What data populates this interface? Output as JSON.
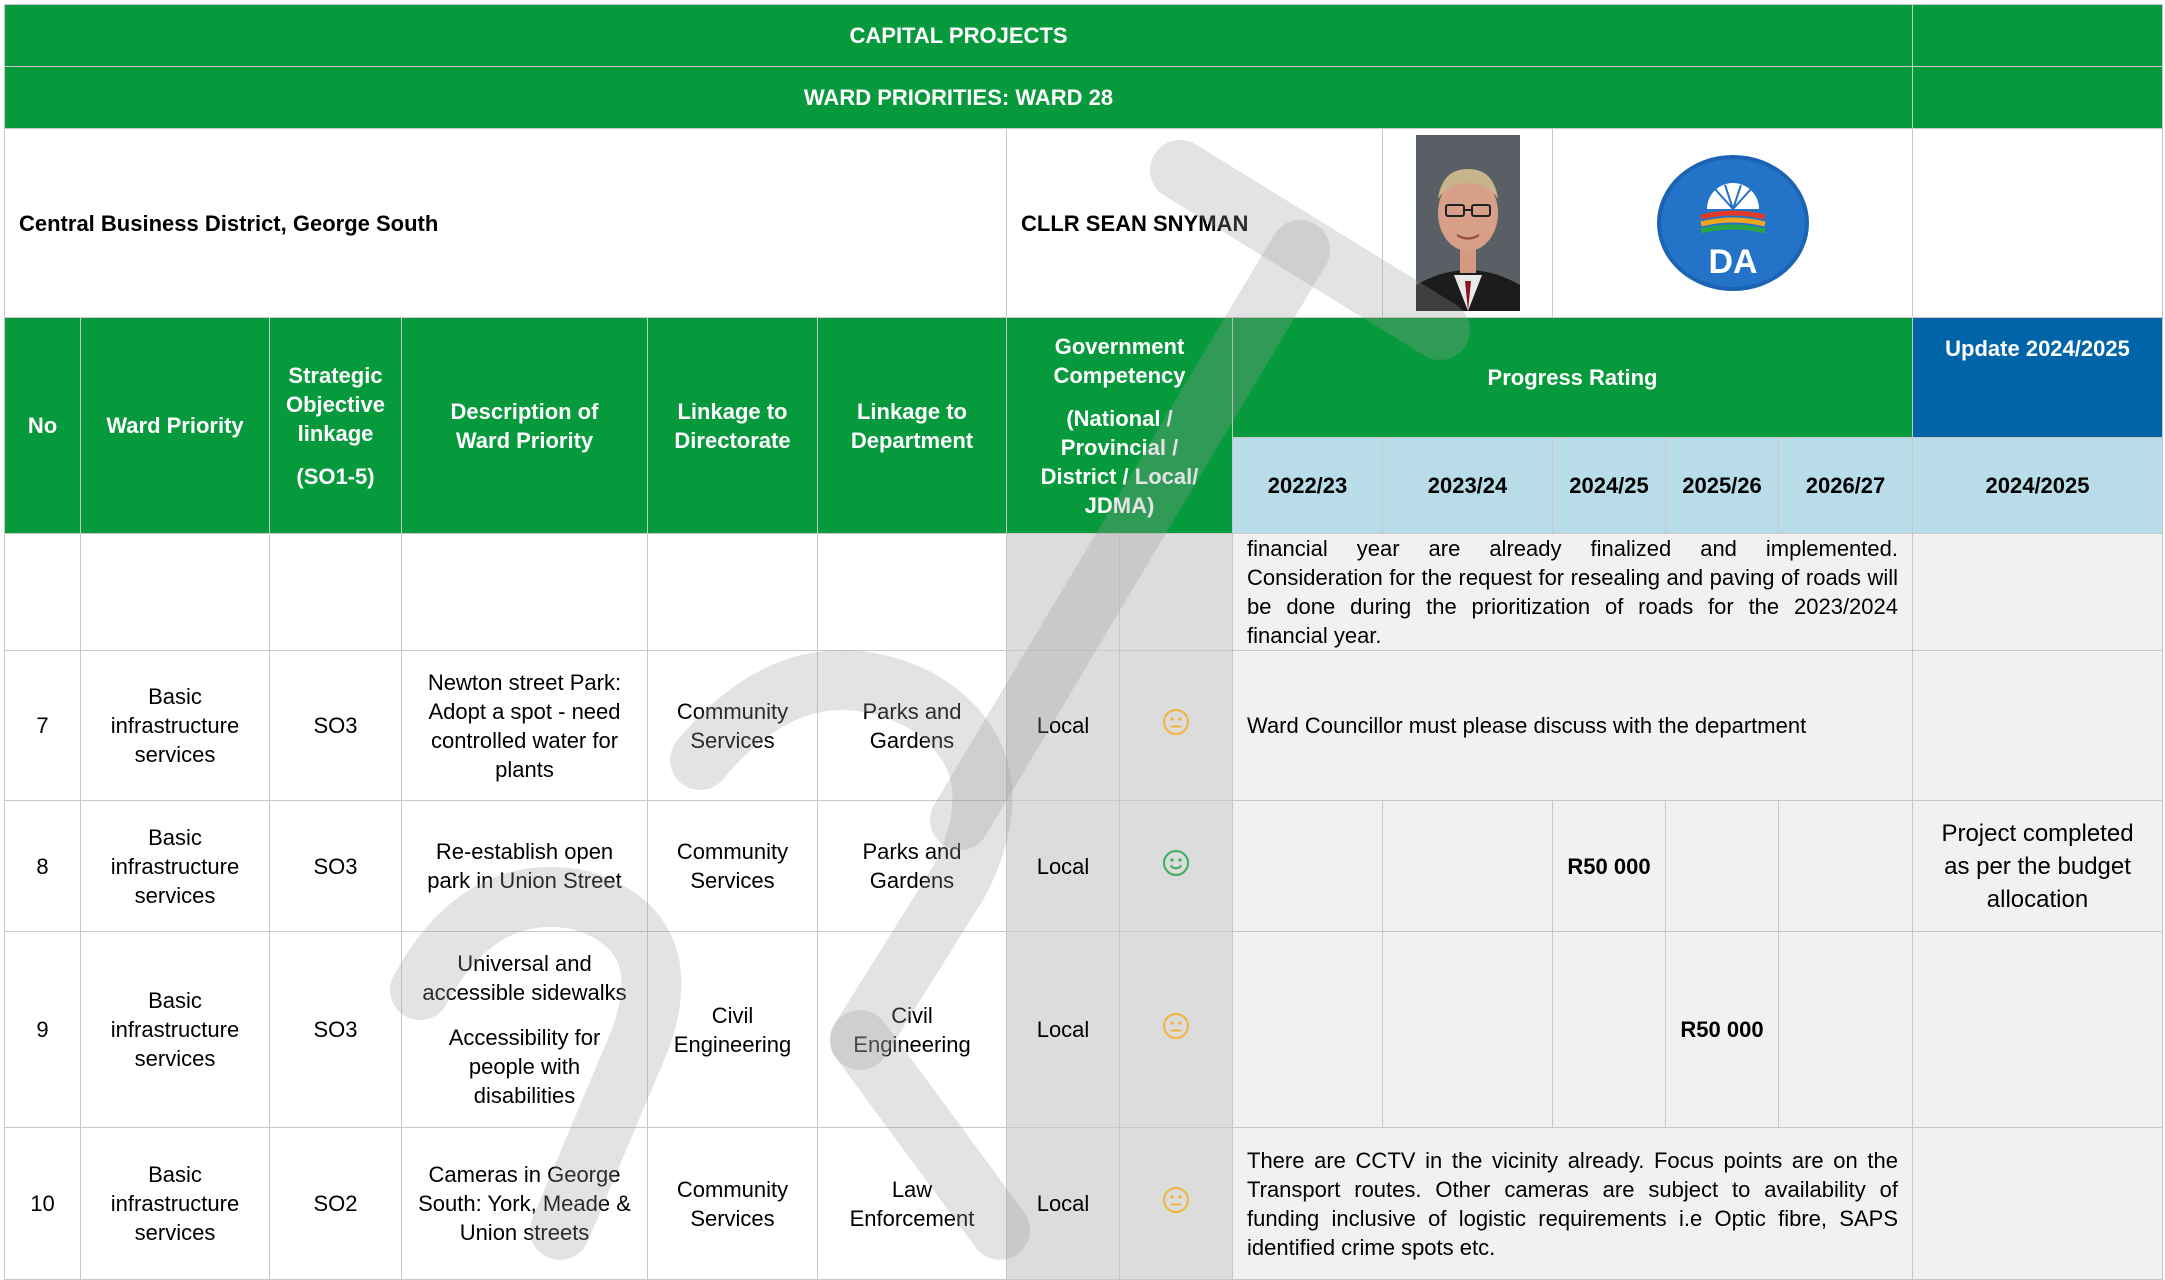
{
  "header": {
    "title": "CAPITAL PROJECTS",
    "subtitle": "WARD PRIORITIES: WARD 28"
  },
  "ward": {
    "area": "Central Business District, George South",
    "councillor": "CLLR SEAN SNYMAN",
    "party_logo_text": "DA"
  },
  "columns": {
    "no": "No",
    "ward_priority": "Ward Priority",
    "strategic_objective": "Strategic Objective linkage",
    "strategic_objective_sub": "(SO1-5)",
    "description": "Description of Ward Priority",
    "directorate": "Linkage to Directorate",
    "department": "Linkage to Department",
    "competency": "Government Competency",
    "competency_sub": "(National / Provincial / District / Local/ JDMA)",
    "progress": "Progress Rating",
    "update": "Update 2024/2025",
    "years": [
      "2022/23",
      "2023/24",
      "2024/25",
      "2025/26",
      "2026/27"
    ],
    "update_year": "2024/2025"
  },
  "rows": [
    {
      "comment": "financial year are already finalized and implemented. Consideration for the request for resealing and paving of roads will be done during the prioritization of roads for the 2023/2024 financial year."
    },
    {
      "no": "7",
      "priority": "Basic infrastructure services",
      "so": "SO3",
      "description": "Newton street Park: Adopt a spot - need controlled water for plants",
      "directorate": "Community Services",
      "department": "Parks and Gardens",
      "competency": "Local",
      "rating": "neutral",
      "comment": "Ward Councillor must please discuss with the department"
    },
    {
      "no": "8",
      "priority": "Basic infrastructure services",
      "so": "SO3",
      "description": "Re-establish open park in Union Street",
      "directorate": "Community Services",
      "department": "Parks and Gardens",
      "competency": "Local",
      "rating": "happy",
      "budget_2024_25": "R50 000",
      "update": "Project completed as per the budget allocation"
    },
    {
      "no": "9",
      "priority": "Basic infrastructure services",
      "so": "SO3",
      "description": "Universal and accessible sidewalks",
      "description_2": "Accessibility for people with disabilities",
      "directorate": "Civil Engineering",
      "department": "Civil Engineering",
      "competency": "Local",
      "rating": "neutral",
      "budget_2025_26": "R50 000"
    },
    {
      "no": "10",
      "priority": "Basic infrastructure services",
      "so": "SO2",
      "description": "Cameras in George South: York, Meade & Union streets",
      "directorate": "Community Services",
      "department": "Law Enforcement",
      "competency": "Local",
      "rating": "neutral",
      "comment": "There are CCTV in the vicinity already. Focus points are on the Transport routes. Other cameras are subject to availability of funding inclusive of logistic requirements i.e Optic fibre, SAPS identified crime spots etc."
    }
  ],
  "colors": {
    "header_green": "#079a3d",
    "update_blue": "#0064a8",
    "year_row_light_blue": "#b8dde8",
    "neutral_face": "#f2b33d",
    "happy_face": "#3bb05c"
  }
}
